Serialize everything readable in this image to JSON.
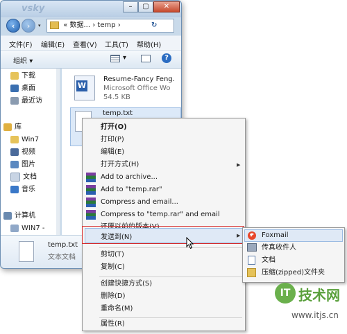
{
  "window": {
    "title_watermark": "vsky",
    "address_path": [
      "«",
      "数据...",
      "temp",
      "›"
    ],
    "address_sep": "›",
    "refresh_icon": "refresh-icon"
  },
  "menubar": [
    "文件(F)",
    "编辑(E)",
    "查看(V)",
    "工具(T)",
    "帮助(H)"
  ],
  "toolbar": {
    "organize_label": "组织",
    "dropdown_glyph": "▾"
  },
  "nav_items": [
    {
      "label": "下载",
      "icon": "download-folder-icon",
      "color": "#e6c35a"
    },
    {
      "label": "桌面",
      "icon": "desktop-icon",
      "color": "#3a6fb0"
    },
    {
      "label": "最近访",
      "icon": "recent-places-icon",
      "color": "#8a9bb0"
    },
    {
      "label": "库",
      "icon": "library-icon",
      "color": "#e0b040"
    },
    {
      "label": "Win7",
      "icon": "folder-icon",
      "color": "#e6c35a"
    },
    {
      "label": "视频",
      "icon": "video-library-icon",
      "color": "#4a6a9a"
    },
    {
      "label": "图片",
      "icon": "pictures-library-icon",
      "color": "#5a88c0"
    },
    {
      "label": "文档",
      "icon": "documents-library-icon",
      "color": "#c8d4e4"
    },
    {
      "label": "音乐",
      "icon": "music-library-icon",
      "color": "#3a78c8"
    },
    {
      "label": "计算机",
      "icon": "computer-icon",
      "color": "#6a8ab0"
    },
    {
      "label": "WIN7 -",
      "icon": "drive-icon",
      "color": "#90a8c8"
    }
  ],
  "files": [
    {
      "name": "Resume-Fancy Feng.",
      "type": "Microsoft Office Wo",
      "size": "54.5 KB"
    },
    {
      "name": "temp.txt"
    }
  ],
  "details": {
    "name": "temp.txt",
    "type": "文本文档"
  },
  "context_menu": {
    "open": "打开(O)",
    "print": "打印(P)",
    "edit": "编辑(E)",
    "open_with": "打开方式(H)",
    "add_archive": "Add to archive...",
    "add_rar": "Add to \"temp.rar\"",
    "compress_email": "Compress and email...",
    "compress_rar_email": "Compress to \"temp.rar\" and email",
    "restore": "还原以前的版本(V)",
    "send_to": "发送到(N)",
    "cut": "剪切(T)",
    "copy": "复制(C)",
    "shortcut": "创建快捷方式(S)",
    "delete": "删除(D)",
    "rename": "重命名(M)",
    "properties": "属性(R)"
  },
  "submenu_arrow": "▶",
  "send_to_menu": [
    "Foxmail",
    "传真收件人",
    "文档",
    "压缩(zipped)文件夹"
  ],
  "watermark": {
    "brand": "技术网",
    "url": "www.itjs.cn"
  }
}
